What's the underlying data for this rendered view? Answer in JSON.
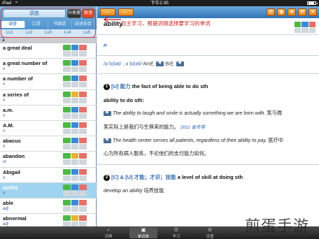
{
  "status_bar": {
    "carrier": "iPad",
    "wifi": "≈",
    "time": "下午2:35",
    "battery_level": 0.75
  },
  "left": {
    "search_label": "调查",
    "btn_dark": "分类搜",
    "btn_red": "取消",
    "tabs": [
      "调查",
      "口语",
      "书面语",
      "自述条目"
    ],
    "levels": [
      "Lv1",
      "Lv2",
      "Lv3",
      "Lv4",
      "Lv5"
    ],
    "letter_head": "a",
    "words": [
      {
        "word": "a great deal",
        "pos": "",
        "selected": false
      },
      {
        "word": "a great number of",
        "pos": "n",
        "selected": false
      },
      {
        "word": "a number of",
        "pos": "n",
        "selected": false
      },
      {
        "word": "a series of",
        "pos": "n",
        "selected": false
      },
      {
        "word": "a.m.",
        "pos": "n",
        "selected": false
      },
      {
        "word": "A.M.",
        "pos": "n",
        "selected": false
      },
      {
        "word": "abacus",
        "pos": "n",
        "selected": false
      },
      {
        "word": "abandon",
        "pos": "vt",
        "selected": false
      },
      {
        "word": "Abigail",
        "pos": "n",
        "selected": false
      },
      {
        "word": "ability",
        "pos": "n",
        "selected": true
      },
      {
        "word": "able",
        "pos": "adj",
        "selected": false
      },
      {
        "word": "abnormal",
        "pos": "adj",
        "selected": false
      }
    ]
  },
  "right": {
    "headword": "ability",
    "annotation": "自主学习，根据词频选择要学习的单词",
    "pos": "n",
    "pronunciation_bre": "/əˈbɪləti/ ; əˈbɪləti/",
    "ame_label": "AmE:",
    "bre_label": "BrE:",
    "tool_icons": [
      "☰",
      "◉",
      "★",
      "⚒",
      "✕"
    ],
    "sense1": {
      "num": "1",
      "gram": "[U]",
      "cn": "能力",
      "def": "the fact of being able to do sth"
    },
    "pattern": "ability to do sth:",
    "ex1": "The ability to laugh and smile is actually something we are born with.",
    "ex1_tail": "笑与微",
    "ex1_cn": "笑实际上是我们与生俱来的能力。",
    "ex1_src": "2011 省市带",
    "ex2": "The health center serves all patients, regardless of their ability to pay.",
    "ex2_tail": "医疗中",
    "ex2_cn": "心为所有病人服务，不论他们的支付能力如何。",
    "sense2": {
      "num": "2",
      "gram": "[C] & [U]",
      "cn": "才能；才识；技能",
      "def": "a level of skill at doing sth"
    },
    "ex3": "develop an ability",
    "ex3_cn": "培养技能"
  },
  "tabbar": {
    "items": [
      {
        "icon": "⌕",
        "label": "词典"
      },
      {
        "icon": "▣",
        "label": "单词本"
      },
      {
        "icon": "☰",
        "label": "学习"
      },
      {
        "icon": "⚙",
        "label": "设置"
      }
    ]
  },
  "watermark": "煎蛋手游"
}
